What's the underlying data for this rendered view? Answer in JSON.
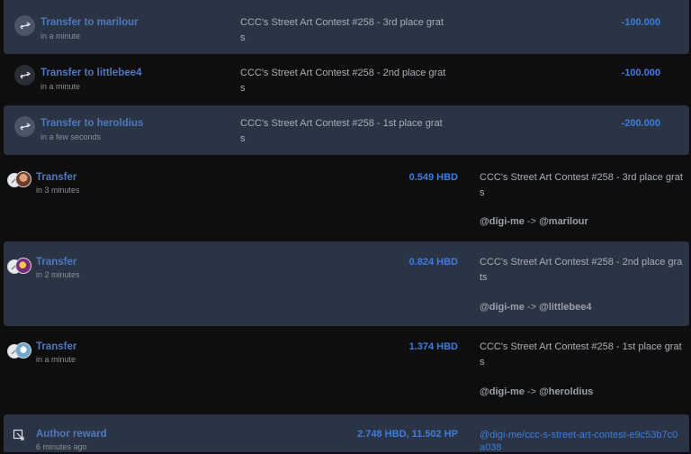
{
  "colors": {
    "background": "#0f0e0f",
    "highlight_row": "#2b3444",
    "title_blue": "#4f78bf",
    "amount_blue": "#3d7dde",
    "memo_gray": "#a8aeb6"
  },
  "outgoing": [
    {
      "icon": "transfer-arrows-icon",
      "title": "Transfer to marilour",
      "time": "in a minute",
      "memo": "CCC's Street Art Contest #258 - 3rd place grats",
      "amount": "-100.000"
    },
    {
      "icon": "transfer-arrows-icon",
      "title": "Transfer to littlebee4",
      "time": "in a minute",
      "memo": "CCC's Street Art Contest #258 - 2nd place grats",
      "amount": "-100.000"
    },
    {
      "icon": "transfer-arrows-icon",
      "title": "Transfer to heroldius",
      "time": "in a few seconds",
      "memo": "CCC's Street Art Contest #258 - 1st place grats",
      "amount": "-200.000"
    }
  ],
  "transfers": [
    {
      "title": "Transfer",
      "time": "in 3 minutes",
      "amount": "0.549 HBD",
      "memo": "CCC's Street Art Contest #258 - 3rd place grats",
      "from": "@digi-me",
      "arrow": "->",
      "to": "@marilour"
    },
    {
      "title": "Transfer",
      "time": "in 2 minutes",
      "amount": "0.824 HBD",
      "memo": "CCC's Street Art Contest #258 - 2nd place grats",
      "from": "@digi-me",
      "arrow": "->",
      "to": "@littlebee4"
    },
    {
      "title": "Transfer",
      "time": "in a minute",
      "amount": "1.374 HBD",
      "memo": "CCC's Street Art Contest #258 - 1st place grats",
      "from": "@digi-me",
      "arrow": "->",
      "to": "@heroldius"
    }
  ],
  "reward": {
    "icon": "author-reward-icon",
    "title": "Author reward",
    "time": "6 minutes ago",
    "amount": "2.748 HBD, 11.502 HP",
    "link": "@digi-me/ccc-s-street-art-contest-e9c53b7c0a038"
  }
}
